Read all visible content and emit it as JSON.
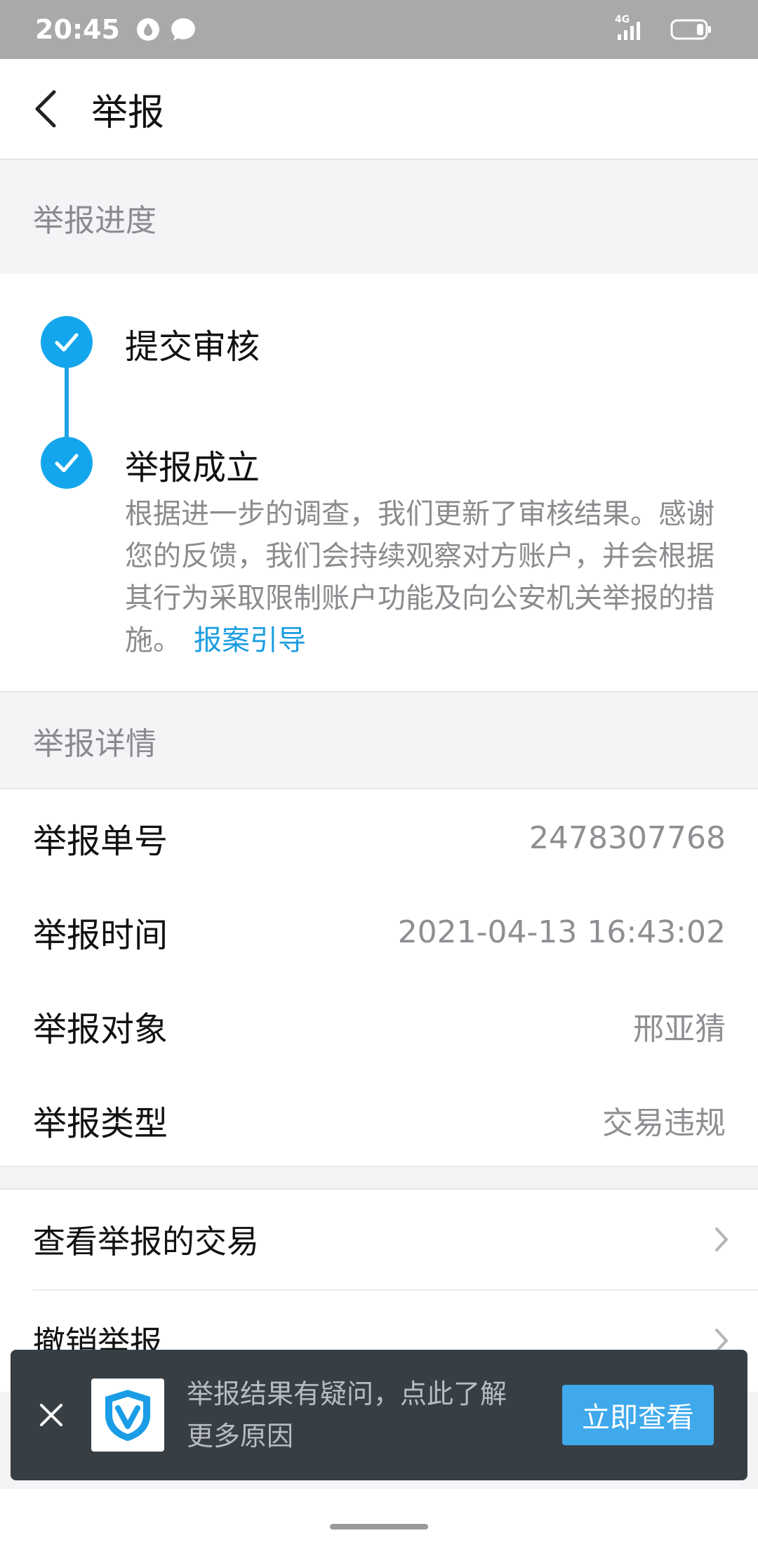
{
  "status_bar": {
    "time": "20:45",
    "network": "4G",
    "icons": [
      "notification-drop-icon",
      "chat-bubble-icon",
      "signal-icon",
      "battery-icon"
    ]
  },
  "header": {
    "title": "举报",
    "back_icon": "chevron-left-icon"
  },
  "progress": {
    "section_title": "举报进度",
    "steps": [
      {
        "title": "提交审核",
        "status": "done"
      },
      {
        "title": "举报成立",
        "status": "done"
      }
    ],
    "description": "根据进一步的调查，我们更新了审核结果。感谢您的反馈，我们会持续观察对方账户，并会根据其行为采取限制账户功能及向公安机关举报的措施。",
    "link_text": "报案引导",
    "accent_color": "#14a6ec"
  },
  "details": {
    "section_title": "举报详情",
    "rows": [
      {
        "label": "举报单号",
        "value": "2478307768"
      },
      {
        "label": "举报时间",
        "value": "2021-04-13 16:43:02"
      },
      {
        "label": "举报对象",
        "value": "邢亚猜"
      },
      {
        "label": "举报类型",
        "value": "交易违规"
      }
    ]
  },
  "actions": [
    {
      "label": "查看举报的交易"
    },
    {
      "label": "撤销举报"
    }
  ],
  "banner": {
    "text": "举报结果有疑问，点此了解更多原因",
    "button_label": "立即查看",
    "logo_icon": "shield-v-icon",
    "close_icon": "close-icon"
  }
}
